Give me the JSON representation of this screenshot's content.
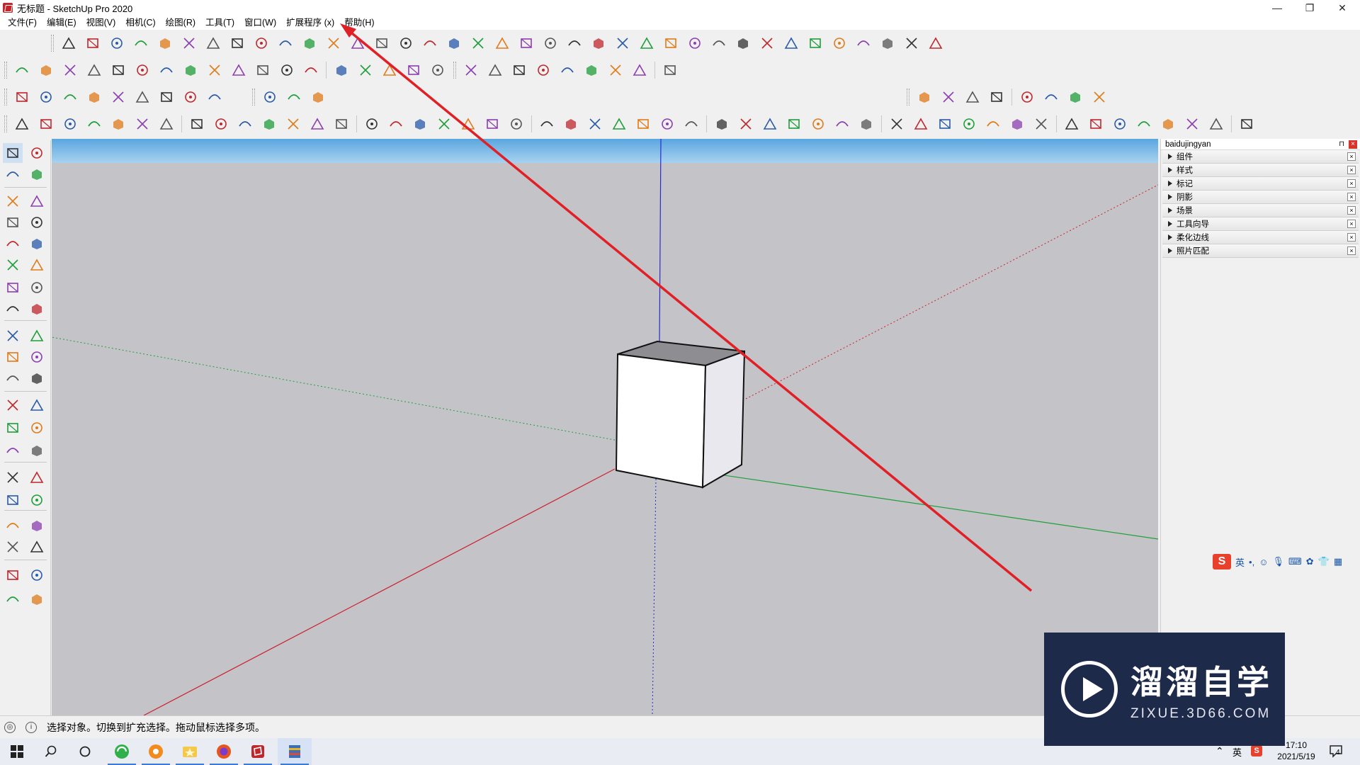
{
  "window": {
    "title": "无标题 - SketchUp Pro 2020",
    "controls": {
      "minimize": "—",
      "restore": "❐",
      "close": "✕"
    }
  },
  "menu": {
    "items": [
      "文件(F)",
      "编辑(E)",
      "视图(V)",
      "相机(C)",
      "绘图(R)",
      "工具(T)",
      "窗口(W)",
      "扩展程序 (x)",
      "帮助(H)"
    ]
  },
  "tray": {
    "title": "baidujingyan",
    "panels": [
      "组件",
      "样式",
      "标记",
      "阴影",
      "场景",
      "工具向导",
      "柔化边线",
      "照片匹配"
    ]
  },
  "status": {
    "message": "选择对象。切换到扩充选择。拖动鼠标选择多项。"
  },
  "ime": {
    "logo": "S",
    "lang": "英",
    "punct": "•,"
  },
  "taskbar": {
    "time": "17:10",
    "date": "2021/5/19",
    "notify_count": "4",
    "tray_lang": "英"
  },
  "watermark": {
    "brand": "溜溜自学",
    "url": "ZIXUE.3D66.COM"
  },
  "colors": {
    "axis_red": "#cc1f2c",
    "axis_green": "#1f9e3a",
    "axis_blue": "#2a2acc",
    "sky": "#74b4e4",
    "ground": "#c4c4c8",
    "annotation": "#e01f26"
  }
}
